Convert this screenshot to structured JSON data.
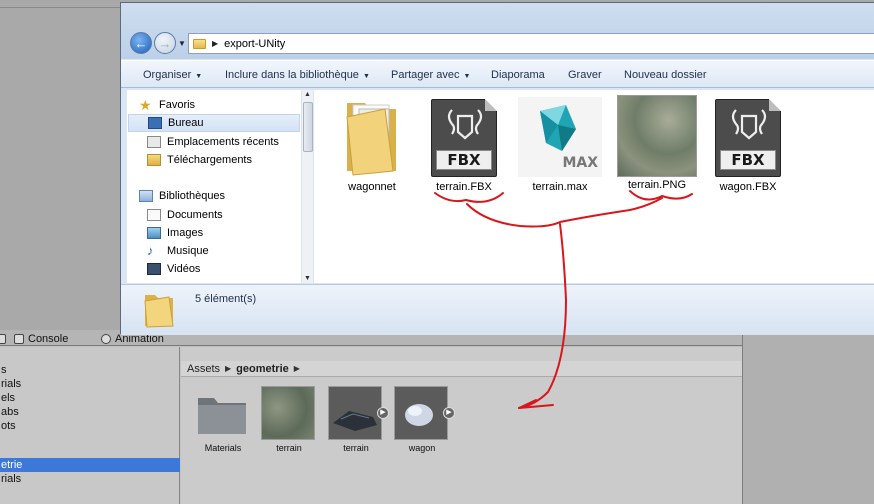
{
  "explorer": {
    "path": "export-UNity",
    "toolbar": {
      "organiser": "Organiser",
      "inclure": "Inclure dans la bibliothèque",
      "partager": "Partager avec",
      "diaporama": "Diaporama",
      "graver": "Graver",
      "nouveau_dossier": "Nouveau dossier"
    },
    "nav": {
      "favoris": "Favoris",
      "bureau": "Bureau",
      "emplacements": "Emplacements récents",
      "telechargements": "Téléchargements",
      "bibliotheques": "Bibliothèques",
      "documents": "Documents",
      "images": "Images",
      "musique": "Musique",
      "videos": "Vidéos"
    },
    "files": [
      {
        "name": "wagonnet",
        "icon": "folder-icon"
      },
      {
        "name": "terrain.FBX",
        "icon": "fbx-file-icon",
        "badge": "FBX"
      },
      {
        "name": "terrain.max",
        "icon": "3dsmax-file-icon",
        "badge": "MAX"
      },
      {
        "name": "terrain.PNG",
        "icon": "image-thumbnail"
      },
      {
        "name": "wagon.FBX",
        "icon": "fbx-file-icon",
        "badge": "FBX"
      }
    ],
    "status": "5 élément(s)"
  },
  "unity": {
    "tabs": {
      "console": "Console",
      "animation": "Animation"
    },
    "left_items": [
      "s",
      "rials",
      "els",
      "abs",
      "ots",
      "etrie",
      "rials"
    ],
    "breadcrumb": {
      "root": "Assets",
      "folder": "geometrie"
    },
    "assets": [
      {
        "name": "Materials",
        "icon": "folder-icon"
      },
      {
        "name": "terrain",
        "icon": "texture-thumbnail"
      },
      {
        "name": "terrain",
        "icon": "model-thumbnail"
      },
      {
        "name": "wagon",
        "icon": "model-thumbnail"
      }
    ]
  },
  "colors": {
    "annotation": "#d8161b",
    "selection": "#3b78d8"
  }
}
